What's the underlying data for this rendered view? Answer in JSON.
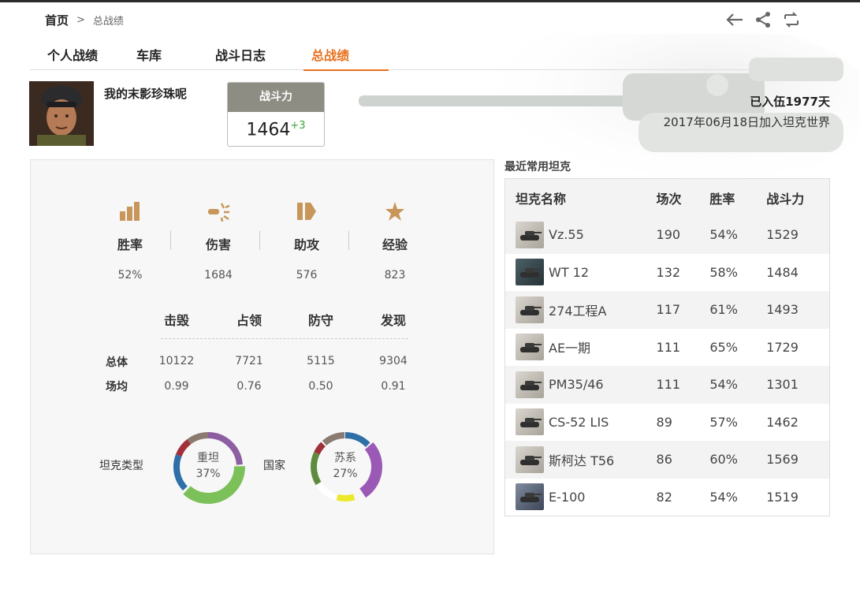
{
  "breadcrumb": {
    "home": "首页",
    "sep": ">",
    "current": "总战绩"
  },
  "tabs": [
    "个人战绩",
    "车库",
    "战斗日志",
    "总战绩"
  ],
  "player": {
    "name": "我的末影珍珠呢"
  },
  "power": {
    "label": "战斗力",
    "value": "1464",
    "delta": "+3"
  },
  "service": {
    "enlisted": "已入伍1977天",
    "joined": "2017年06月18日加入坦克世界"
  },
  "main_stats": [
    {
      "icon": "bar-chart-icon",
      "label": "胜率",
      "value": "52%"
    },
    {
      "icon": "shell-burst-icon",
      "label": "伤害",
      "value": "1684"
    },
    {
      "icon": "assist-icon",
      "label": "助攻",
      "value": "576"
    },
    {
      "icon": "star-icon",
      "label": "经验",
      "value": "823"
    }
  ],
  "sub_headers": [
    "击毁",
    "占领",
    "防守",
    "发现"
  ],
  "rows": [
    {
      "label": "总体",
      "values": [
        "10122",
        "7721",
        "5115",
        "9304"
      ]
    },
    {
      "label": "场均",
      "values": [
        "0.99",
        "0.76",
        "0.50",
        "0.91"
      ]
    }
  ],
  "donuts": [
    {
      "label": "坦克类型",
      "center": "重坦",
      "pct": "37%",
      "highlight": 0.37,
      "color": "#7cc05a"
    },
    {
      "label": "国家",
      "center": "苏系",
      "pct": "27%",
      "highlight": 0.27,
      "color": "#9b59b6"
    }
  ],
  "recent": {
    "title": "最近常用坦克",
    "headers": [
      "坦克名称",
      "场次",
      "胜率",
      "战斗力"
    ],
    "tanks": [
      {
        "name": "Vz.55",
        "battles": "190",
        "win": "54%",
        "power": "1529",
        "icon": "tank-icon"
      },
      {
        "name": "WT 12",
        "battles": "132",
        "win": "58%",
        "power": "1484",
        "icon": "tank-icon"
      },
      {
        "name": "274工程A",
        "battles": "117",
        "win": "61%",
        "power": "1493",
        "icon": "tank-icon"
      },
      {
        "name": "AE一期",
        "battles": "111",
        "win": "65%",
        "power": "1729",
        "icon": "tank-icon"
      },
      {
        "name": "PM35/46",
        "battles": "111",
        "win": "54%",
        "power": "1301",
        "icon": "tank-icon"
      },
      {
        "name": "CS-52 LIS",
        "battles": "89",
        "win": "57%",
        "power": "1462",
        "icon": "tank-icon"
      },
      {
        "name": "斯柯达 T56",
        "battles": "86",
        "win": "60%",
        "power": "1569",
        "icon": "tank-icon"
      },
      {
        "name": "E-100",
        "battles": "82",
        "win": "54%",
        "power": "1519",
        "icon": "tank-icon"
      }
    ]
  },
  "colors": {
    "accent": "#e8711b",
    "icon": "#c8955a",
    "positive": "#3aa33a"
  }
}
